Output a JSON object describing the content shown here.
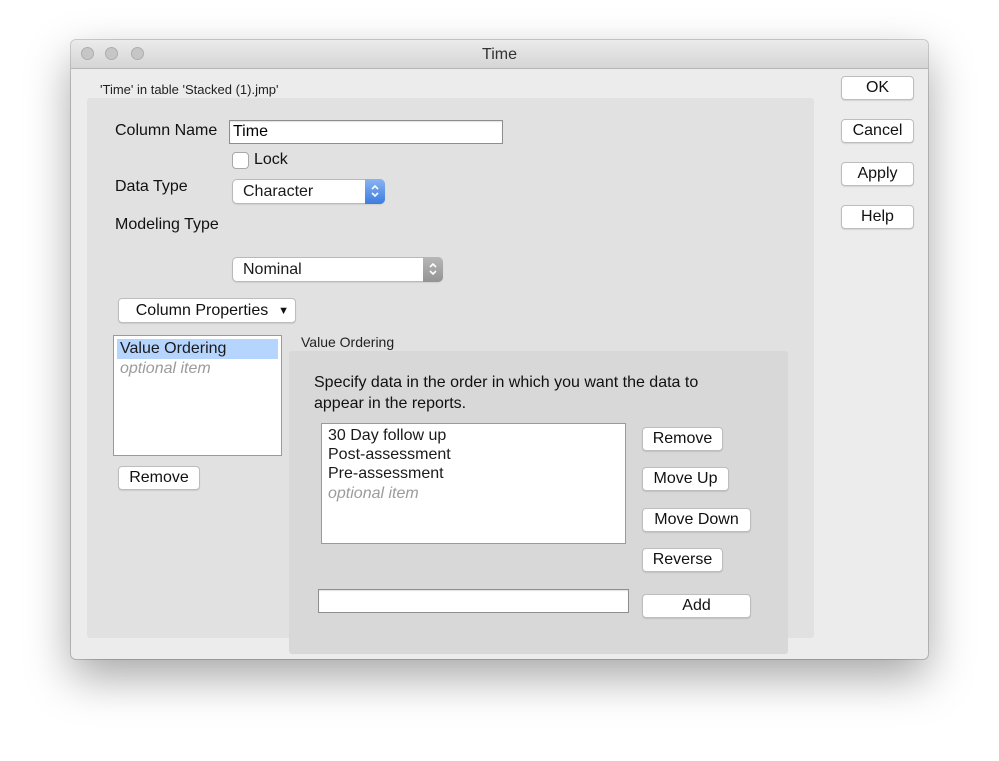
{
  "window": {
    "title": "Time",
    "context_label": "'Time' in table 'Stacked (1).jmp'"
  },
  "form": {
    "column_name_label": "Column Name",
    "column_name_value": "Time",
    "lock_label": "Lock",
    "data_type_label": "Data Type",
    "data_type_value": "Character",
    "modeling_type_label": "Modeling Type",
    "modeling_type_value": "Nominal",
    "column_properties_label": "Column Properties"
  },
  "properties_list": {
    "items": [
      "Value Ordering"
    ],
    "placeholder": "optional item",
    "remove_label": "Remove"
  },
  "value_ordering": {
    "section_title": "Value Ordering",
    "description": "Specify data in the order in which you want the data to appear in the reports.",
    "items": [
      "30 Day follow up",
      "Post-assessment",
      "Pre-assessment"
    ],
    "placeholder": "optional item",
    "remove_label": "Remove",
    "move_up_label": "Move Up",
    "move_down_label": "Move Down",
    "reverse_label": "Reverse",
    "add_label": "Add",
    "add_field_value": ""
  },
  "actions": {
    "ok": "OK",
    "cancel": "Cancel",
    "apply": "Apply",
    "help": "Help"
  },
  "colors": {
    "selection": "#b5d5ff",
    "popup_accent": "#3b7ce0"
  }
}
